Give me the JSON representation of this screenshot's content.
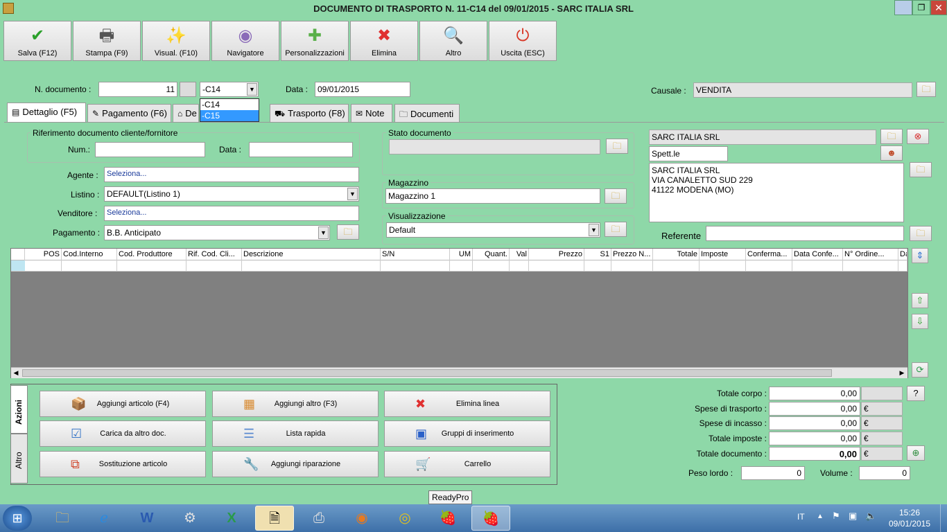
{
  "window": {
    "title": "DOCUMENTO DI TRASPORTO N. 11-C14 del 09/01/2015 - SARC ITALIA SRL"
  },
  "toolbar": [
    {
      "label": "Salva (F12)",
      "icon": "check-icon",
      "glyph": "✔",
      "color": "#2aa02a"
    },
    {
      "label": "Stampa (F9)",
      "icon": "printer-icon",
      "glyph": "🖶",
      "color": "#555555"
    },
    {
      "label": "Visual. (F10)",
      "icon": "magic-wand-icon",
      "glyph": "✨",
      "color": "#d4a020"
    },
    {
      "label": "Navigatore",
      "icon": "compass-icon",
      "glyph": "◉",
      "color": "#8a6ab8"
    },
    {
      "label": "Personalizzazioni",
      "icon": "puzzle-icon",
      "glyph": "✚",
      "color": "#5ab04a"
    },
    {
      "label": "Elimina",
      "icon": "delete-x-icon",
      "glyph": "✖",
      "color": "#e03030"
    },
    {
      "label": "Altro",
      "icon": "magnifier-icon",
      "glyph": "🔍",
      "color": "#3a78c8"
    },
    {
      "label": "Uscita (ESC)",
      "icon": "power-icon",
      "glyph": "⏻",
      "color": "#d83a2a"
    }
  ],
  "header": {
    "ndoc_label": "N. documento :",
    "ndoc_value": "11",
    "series_value": "-C14",
    "series_options": [
      "-C14",
      "-C15"
    ],
    "data_label": "Data :",
    "data_value": "09/01/2015",
    "causale_label": "Causale :",
    "causale_value": "VENDITA"
  },
  "tabs": [
    {
      "label": "Dettaglio (F5)",
      "icon": "detail-icon"
    },
    {
      "label": "Pagamento (F6)",
      "icon": "payment-icon"
    },
    {
      "label": "De",
      "icon": "destination-icon"
    },
    {
      "label": "Trasporto (F8)",
      "icon": "truck-icon"
    },
    {
      "label": "Note",
      "icon": "note-icon"
    },
    {
      "label": "Documenti",
      "icon": "documents-icon"
    }
  ],
  "riferimento": {
    "title": "Riferimento documento cliente/fornitore",
    "num_label": "Num.:",
    "num_value": "",
    "data_label": "Data :",
    "data_value": ""
  },
  "fields": {
    "agente_label": "Agente :",
    "agente_value": "Seleziona...",
    "listino_label": "Listino :",
    "listino_value": "DEFAULT(Listino 1)",
    "venditore_label": "Venditore :",
    "venditore_value": "Seleziona...",
    "pagamento_label": "Pagamento :",
    "pagamento_value": "B.B. Anticipato"
  },
  "stato": {
    "title": "Stato documento",
    "value": ""
  },
  "magazzino": {
    "title": "Magazzino",
    "value": "Magazzino 1"
  },
  "visualizzazione": {
    "title": "Visualizzazione",
    "value": "Default"
  },
  "cliente": {
    "name": "SARC ITALIA SRL",
    "salutation": "Spett.le",
    "address": [
      "SARC ITALIA SRL",
      "VIA CANALETTO SUD 229",
      "41122 MODENA (MO)"
    ],
    "referente_label": "Referente",
    "referente_value": ""
  },
  "grid": {
    "columns": [
      "POS",
      "Cod.Interno",
      "Cod. Produttore",
      "Rif. Cod. Cli...",
      "Descrizione",
      "S/N",
      "UM",
      "Quant.",
      "Val",
      "Prezzo",
      "S1",
      "Prezzo N...",
      "Totale",
      "Imposte",
      "Conferma...",
      "Data Confe...",
      "N° Ordine...",
      "Data"
    ]
  },
  "actions": {
    "side_tabs": [
      "Azioni",
      "Altro"
    ],
    "buttons": [
      {
        "label": "Aggiungi articolo (F4)",
        "icon": "add-article-icon",
        "glyph": "📦"
      },
      {
        "label": "Aggiungi altro (F3)",
        "icon": "add-other-icon",
        "glyph": "▦"
      },
      {
        "label": "Elimina linea",
        "icon": "delete-line-icon",
        "glyph": "✖"
      },
      {
        "label": "Carica da altro doc.",
        "icon": "load-doc-icon",
        "glyph": "☑"
      },
      {
        "label": "Lista rapida",
        "icon": "quick-list-icon",
        "glyph": "☰"
      },
      {
        "label": "Gruppi di inserimento",
        "icon": "insert-group-icon",
        "glyph": "▣"
      },
      {
        "label": "Sostituzione articolo",
        "icon": "replace-article-icon",
        "glyph": "⧉"
      },
      {
        "label": "Aggiungi riparazione",
        "icon": "wrench-icon",
        "glyph": "🔧"
      },
      {
        "label": "Carrello",
        "icon": "cart-icon",
        "glyph": "🛒"
      }
    ]
  },
  "totals": {
    "corpo_label": "Totale corpo :",
    "corpo_value": "0,00",
    "trasporto_label": "Spese di trasporto :",
    "trasporto_value": "0,00",
    "incasso_label": "Spese di incasso :",
    "incasso_value": "0,00",
    "imposte_label": "Totale imposte :",
    "imposte_value": "0,00",
    "documento_label": "Totale documento :",
    "documento_value": "0,00",
    "currency": "€",
    "help": "?",
    "peso_label": "Peso lordo :",
    "peso_value": "0",
    "volume_label": "Volume :",
    "volume_value": "0"
  },
  "tooltip": "ReadyPro",
  "taskbar": {
    "lang": "IT",
    "time": "15:26",
    "date": "09/01/2015"
  }
}
